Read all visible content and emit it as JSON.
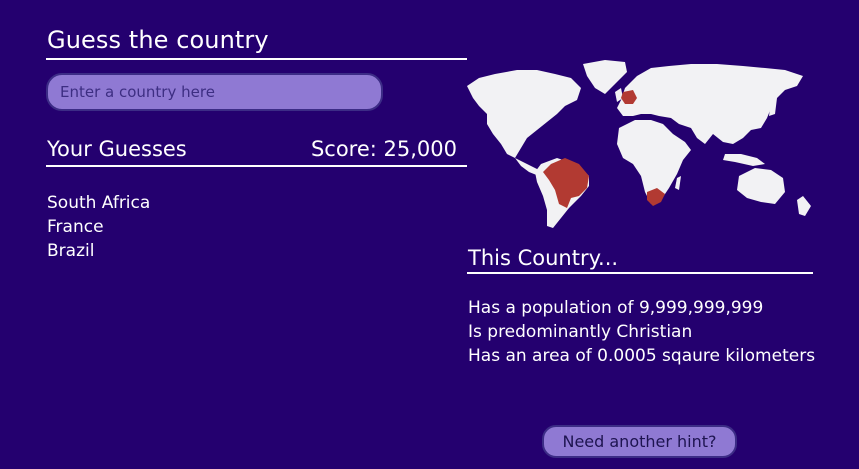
{
  "header": {
    "title": "Guess the country"
  },
  "search": {
    "placeholder": "Enter a country here",
    "value": ""
  },
  "guesses": {
    "heading": "Your Guesses",
    "score": "Score: 25,000",
    "items": [
      "South Africa",
      "France",
      "Brazil"
    ]
  },
  "map": {
    "land_color": "#f2f2f4",
    "highlight_color": "#b23a32",
    "highlighted": [
      "South Africa",
      "France",
      "Brazil"
    ]
  },
  "hints": {
    "heading": "This Country...",
    "items": [
      "Has a population of 9,999,999,999",
      "Is predominantly Christian",
      "Has an area of 0.0005 sqaure kilometers"
    ],
    "button_label": "Need another hint?"
  },
  "colors": {
    "background": "#24006f",
    "input_fill": "#8f79d3",
    "input_border": "#3c2c86",
    "text": "#ffffff"
  }
}
